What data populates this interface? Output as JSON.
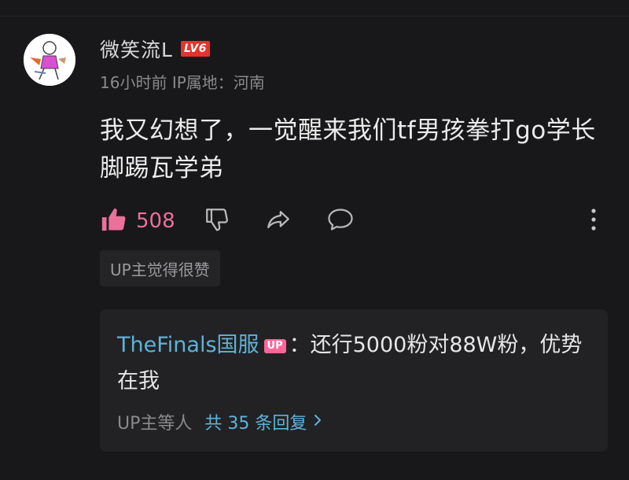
{
  "comment": {
    "username": "微笑流L",
    "level": "LV6",
    "time": "16小时前",
    "ip_location": "IP属地：河南",
    "text": "我又幻想了，一觉醒来我们tf男孩拳打go学长脚踢瓦学弟",
    "likes": "508",
    "up_liked_label": "UP主觉得很赞"
  },
  "reply": {
    "author": "TheFinals国服",
    "author_badge": "UP",
    "text": "：还行5000粉对88W粉，优势在我",
    "footer_who": "UP主等人",
    "footer_count": "共 35 条回复"
  },
  "colors": {
    "background": "#18181a",
    "like_accent": "#e9719a",
    "link_blue": "#5fb3d9",
    "level_red": "#e5332f",
    "up_pink": "#ff6699"
  },
  "icons": [
    "thumbs-up-icon",
    "thumbs-down-icon",
    "share-icon",
    "comment-icon",
    "more-vertical-icon",
    "chevron-right-icon"
  ]
}
